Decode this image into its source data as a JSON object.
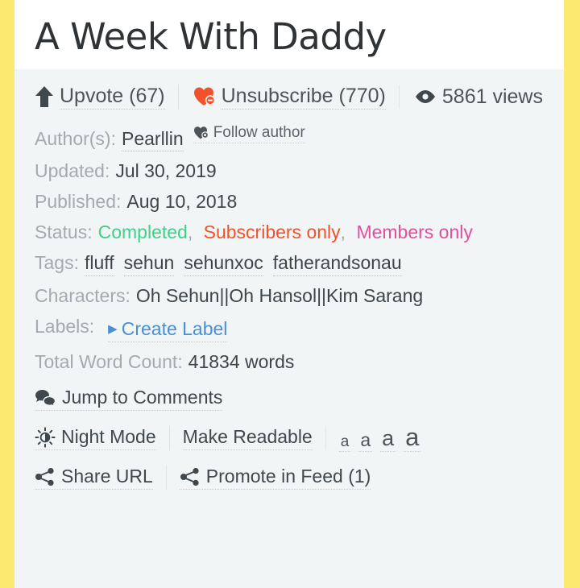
{
  "page": {
    "border_color": "#fce96f",
    "background": "#f2f5f6",
    "title_bar_background": "#ffffff"
  },
  "header": {
    "title": "A Week With Daddy"
  },
  "stats": [
    {
      "icon": "up-arrow-icon",
      "label": "Upvote (67)",
      "name": "upvote-button",
      "interactable": true
    },
    {
      "icon": "heart-minus-icon",
      "label": "Unsubscribe (770)",
      "name": "unsubscribe-button",
      "interactable": true
    },
    {
      "icon": "eye-icon",
      "label": "5861 views",
      "name": "view-count",
      "interactable": false
    }
  ],
  "meta": {
    "author_key": "Author(s):",
    "author_value": "Pearllin",
    "follow_author_label": "Follow author",
    "follow_author_icon": "heart-badge-icon",
    "updated_key": "Updated:",
    "updated_value": "Jul 30, 2019",
    "published_key": "Published:",
    "published_value": "Aug 10, 2018",
    "status_key": "Status:",
    "status_values": [
      {
        "text": "Completed",
        "color": "#3fd08a"
      },
      {
        "text": "Subscribers only",
        "color": "#f0522b"
      },
      {
        "text": "Members only",
        "color": "#e0519a"
      }
    ],
    "status_separator": ",",
    "tags_key": "Tags:",
    "tags": [
      "fluff",
      "sehun",
      "sehunxoc",
      "fatherandsonau"
    ],
    "characters_key": "Characters:",
    "characters_value": "Oh Sehun||Oh Hansol||Kim Sarang",
    "labels_key": "Labels:",
    "create_label_text": "Create Label",
    "create_label_color": "#4a8fd6",
    "word_count_key": "Total Word Count:",
    "word_count_value": "41834 words"
  },
  "actions": {
    "jump_to_comments": "Jump to Comments",
    "jump_to_comments_icon": "comments-icon",
    "night_mode": "Night Mode",
    "night_mode_icon": "brightness-icon",
    "make_readable": "Make Readable",
    "font_sizes": [
      "a",
      "a",
      "a",
      "a"
    ],
    "share_url": "Share URL",
    "share_url_icon": "share-icon",
    "promote_in_feed": "Promote in Feed (1)",
    "promote_icon": "share-icon"
  }
}
